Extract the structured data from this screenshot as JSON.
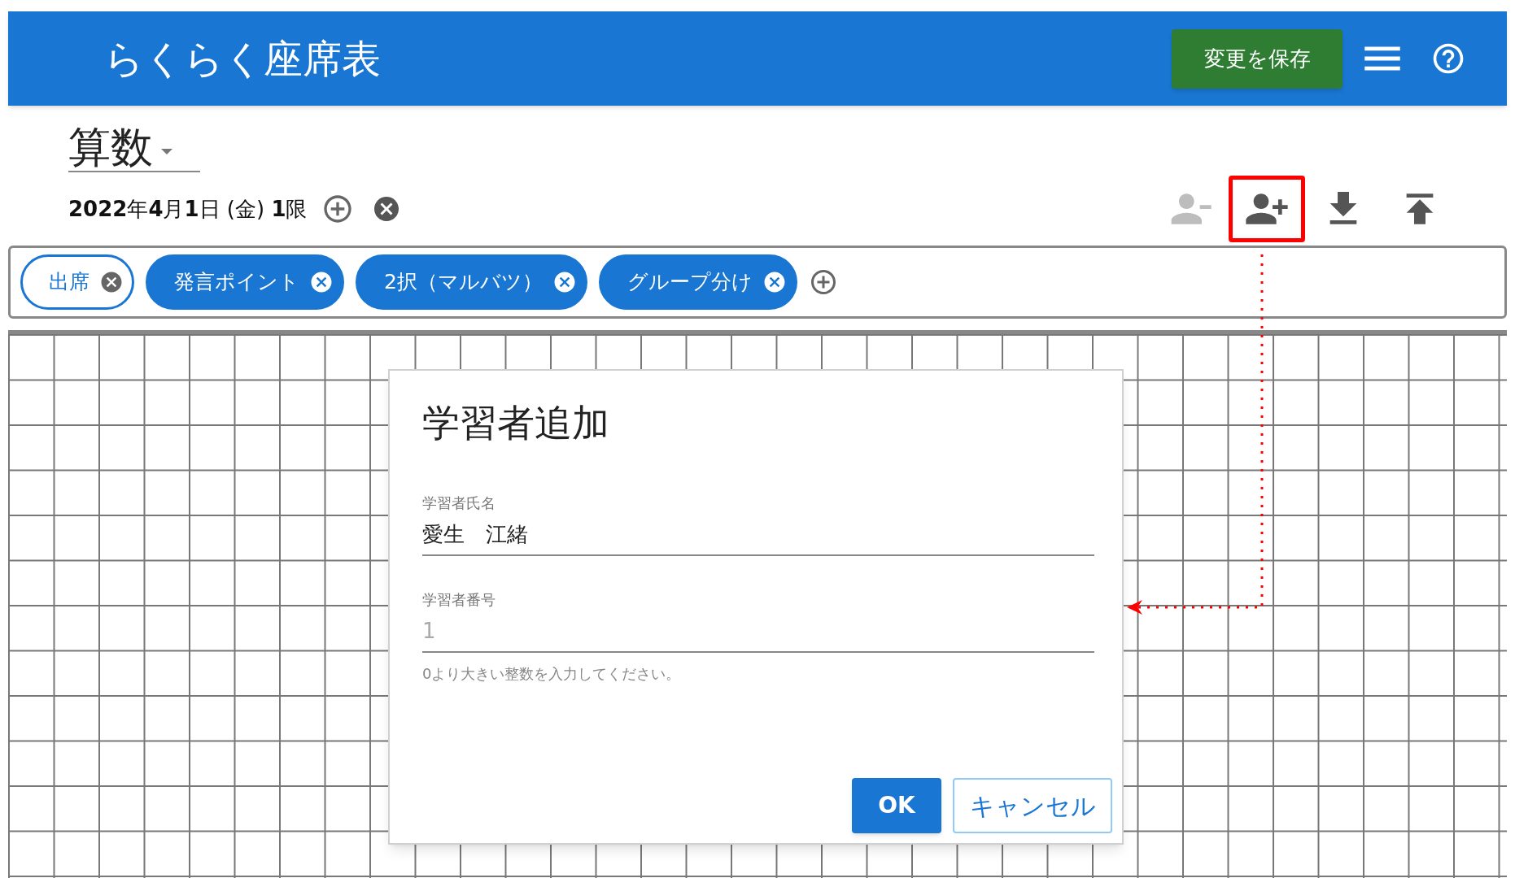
{
  "app": {
    "title": "らくらく座席表",
    "save_button": "変更を保存"
  },
  "subject": {
    "value": "算数"
  },
  "session": {
    "label": "**2022**年**4**月**1**日 (金) **1**限"
  },
  "toolbar": [
    {
      "kind": "remove",
      "disabled": true,
      "highlighted": false
    },
    {
      "kind": "add",
      "disabled": false,
      "highlighted": true
    },
    {
      "kind": "download",
      "disabled": false,
      "highlighted": false
    },
    {
      "kind": "upload",
      "disabled": false,
      "highlighted": false
    }
  ],
  "chips": [
    {
      "label": "出席",
      "selected": true
    },
    {
      "label": "発言ポイント",
      "selected": false
    },
    {
      "label": "2択（マルバツ）",
      "selected": false
    },
    {
      "label": "グループ分け",
      "selected": false
    }
  ],
  "dialog": {
    "title": "学習者追加",
    "fields": [
      {
        "label": "学習者氏名",
        "value": "愛生　江緒"
      },
      {
        "label": "学習者番号",
        "placeholder": "1",
        "hint": "0より大きい整数を入力してください。"
      }
    ],
    "buttons": [
      {
        "label": "OK",
        "kind": "primary"
      },
      {
        "label": "キャンセル",
        "kind": "secondary"
      }
    ]
  }
}
